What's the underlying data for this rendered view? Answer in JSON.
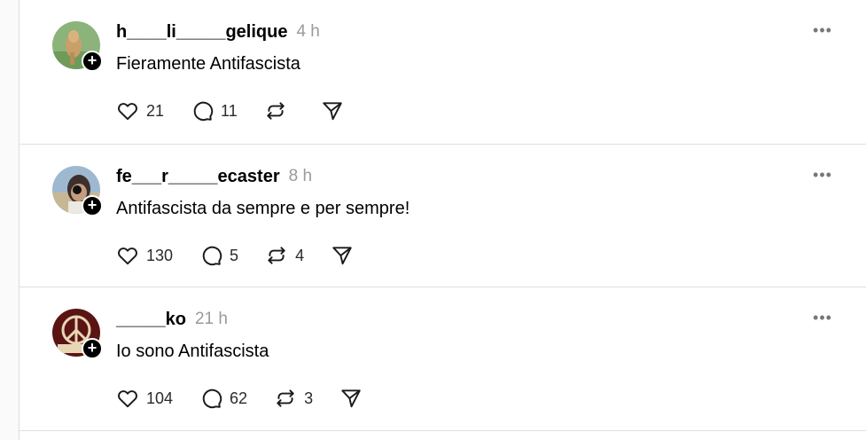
{
  "posts": [
    {
      "username": "h____li_____gelique",
      "time": "4 h",
      "text": "Fieramente Antifascista",
      "likes": "21",
      "replies": "11",
      "reposts": "",
      "more_label": "•••"
    },
    {
      "username": "fe___r_____ecaster",
      "time": "8 h",
      "text": "Antifascista da sempre e per sempre!",
      "likes": "130",
      "replies": "5",
      "reposts": "4",
      "more_label": "•••"
    },
    {
      "username": "_____ko",
      "time": "21 h",
      "text": "Io sono Antifascista",
      "likes": "104",
      "replies": "62",
      "reposts": "3",
      "more_label": "•••"
    }
  ],
  "follow_badge": "+",
  "icons": {
    "like": "heart-icon",
    "reply": "comment-icon",
    "repost": "repost-icon",
    "share": "send-icon",
    "more": "more-icon"
  },
  "colors": {
    "text": "#000000",
    "muted": "#9a9a9a",
    "divider": "#e0e0e0"
  }
}
